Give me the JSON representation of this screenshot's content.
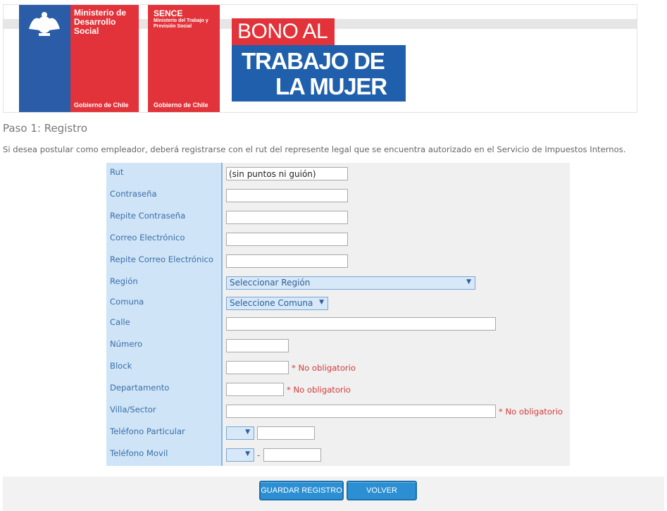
{
  "header": {
    "ministerio_name": "Ministerio de Desarrollo Social",
    "gobierno_label": "Gobierno de Chile",
    "sence_title": "SENCE",
    "sence_subtitle": "Ministerio del Trabajo y Previsión Social",
    "sence_gobierno_label": "Gobierno de Chile",
    "bono_line1": "BONO AL",
    "bono_line2": "TRABAJO DE",
    "bono_line3": "LA MUJER",
    "colors": {
      "brand_blue": "#1f5fab",
      "brand_red": "#e3333a"
    }
  },
  "page": {
    "step_title": "Paso 1: Registro",
    "intro": "Si desea postular como empleador, deberá registrarse con el rut del represente legal que se encuentra autorizado en el Servicio de Impuestos Internos."
  },
  "form": {
    "labels": {
      "rut": "Rut",
      "password": "Contraseña",
      "password_repeat": "Repite Contraseña",
      "email": "Correo Electrónico",
      "email_repeat": "Repite Correo Electrónico",
      "region": "Región",
      "comuna": "Comuna",
      "calle": "Calle",
      "numero": "Número",
      "block": "Block",
      "departamento": "Departamento",
      "villa": "Villa/Sector",
      "telefono_particular": "Teléfono Particular",
      "telefono_movil": "Teléfono Movil"
    },
    "rut_value": "(sin puntos ni guión)",
    "region_selected": "Seleccionar Región",
    "comuna_selected": "Seleccione Comuna",
    "phone_separator": "-",
    "optional_note_block": "* No obligatorio",
    "optional_note_departamento": "* No obligatorio",
    "optional_note_villa": "* No obligatorio"
  },
  "buttons": {
    "save": "GUARDAR REGISTRO",
    "back": "VOLVER"
  }
}
